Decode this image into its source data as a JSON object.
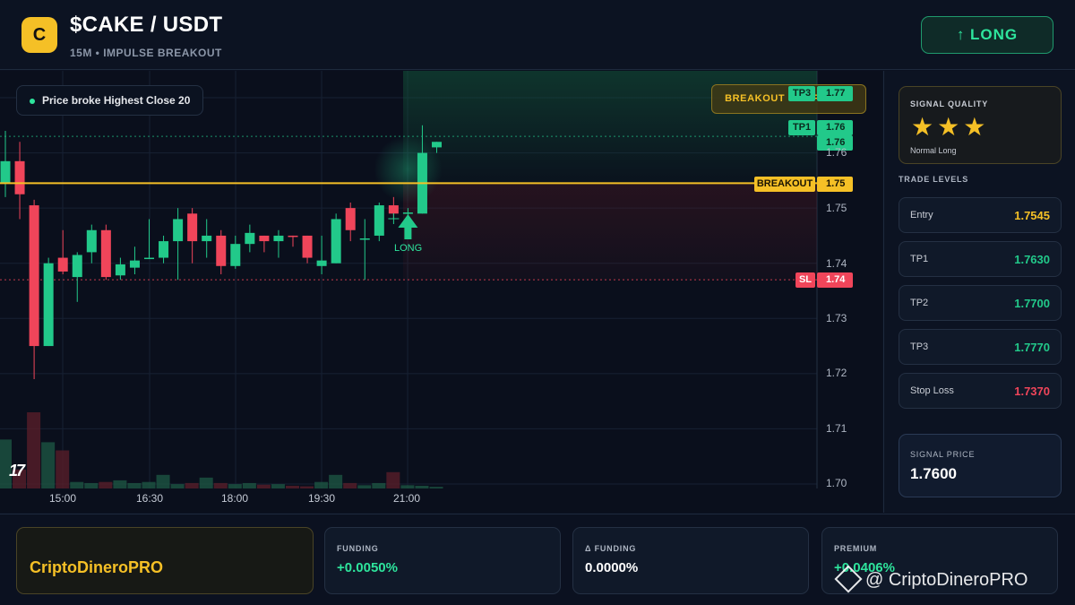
{
  "header": {
    "logo_letter": "C",
    "pair": "$CAKE / USDT",
    "subtitle": "15M • IMPULSE BREAKOUT",
    "direction_button": "↑ LONG"
  },
  "chart": {
    "badge": "Price broke Highest Close 20",
    "confirmed_badge": "BREAKOUT CONFIRMED",
    "tv_logo": "17",
    "long_marker_label": "LONG",
    "time_labels": [
      "15:00",
      "16:30",
      "18:00",
      "19:30",
      "21:00"
    ],
    "price_axis": [
      "1.76",
      "1.75",
      "1.74",
      "1.73",
      "1.72",
      "1.71",
      "1.70"
    ],
    "line_tags": {
      "tp1": {
        "label": "TP1",
        "value": "1.76"
      },
      "tp3": {
        "label": "TP3",
        "value": "1.77"
      },
      "current": {
        "value": "1.76"
      },
      "breakout": {
        "label": "BREAKOUT",
        "value": "1.75"
      },
      "sl": {
        "label": "SL",
        "value": "1.74"
      }
    },
    "colors": {
      "up": "#22c98a",
      "down": "#f0455a",
      "breakout": "#f5c026",
      "bg": "#0a0f1c"
    }
  },
  "chart_data": {
    "type": "candlestick",
    "interval": "15m",
    "y_axis": {
      "min": 1.7,
      "max": 1.77
    },
    "levels": {
      "tp1": 1.763,
      "tp3": 1.777,
      "breakout": 1.7545,
      "sl": 1.737
    },
    "candles": [
      {
        "o": 1.7545,
        "h": 1.764,
        "l": 1.752,
        "c": 1.7585
      },
      {
        "o": 1.7585,
        "h": 1.762,
        "l": 1.748,
        "c": 1.7525
      },
      {
        "o": 1.7505,
        "h": 1.7515,
        "l": 1.719,
        "c": 1.725
      },
      {
        "o": 1.725,
        "h": 1.741,
        "l": 1.725,
        "c": 1.74
      },
      {
        "o": 1.741,
        "h": 1.746,
        "l": 1.738,
        "c": 1.7385
      },
      {
        "o": 1.7375,
        "h": 1.742,
        "l": 1.733,
        "c": 1.7415
      },
      {
        "o": 1.742,
        "h": 1.747,
        "l": 1.74,
        "c": 1.746
      },
      {
        "o": 1.746,
        "h": 1.747,
        "l": 1.737,
        "c": 1.7375
      },
      {
        "o": 1.7378,
        "h": 1.741,
        "l": 1.737,
        "c": 1.7398
      },
      {
        "o": 1.7392,
        "h": 1.743,
        "l": 1.738,
        "c": 1.7405
      },
      {
        "o": 1.741,
        "h": 1.748,
        "l": 1.741,
        "c": 1.741
      },
      {
        "o": 1.741,
        "h": 1.745,
        "l": 1.74,
        "c": 1.744
      },
      {
        "o": 1.744,
        "h": 1.75,
        "l": 1.737,
        "c": 1.748
      },
      {
        "o": 1.749,
        "h": 1.75,
        "l": 1.74,
        "c": 1.744
      },
      {
        "o": 1.744,
        "h": 1.748,
        "l": 1.741,
        "c": 1.745
      },
      {
        "o": 1.745,
        "h": 1.746,
        "l": 1.738,
        "c": 1.7395
      },
      {
        "o": 1.7395,
        "h": 1.745,
        "l": 1.739,
        "c": 1.7435
      },
      {
        "o": 1.7435,
        "h": 1.747,
        "l": 1.742,
        "c": 1.7455
      },
      {
        "o": 1.745,
        "h": 1.745,
        "l": 1.742,
        "c": 1.744
      },
      {
        "o": 1.744,
        "h": 1.746,
        "l": 1.741,
        "c": 1.745
      },
      {
        "o": 1.745,
        "h": 1.745,
        "l": 1.743,
        "c": 1.7448
      },
      {
        "o": 1.745,
        "h": 1.745,
        "l": 1.74,
        "c": 1.741
      },
      {
        "o": 1.7395,
        "h": 1.745,
        "l": 1.738,
        "c": 1.7405
      },
      {
        "o": 1.74,
        "h": 1.749,
        "l": 1.74,
        "c": 1.748
      },
      {
        "o": 1.75,
        "h": 1.751,
        "l": 1.744,
        "c": 1.746
      },
      {
        "o": 1.7443,
        "h": 1.748,
        "l": 1.737,
        "c": 1.7445
      },
      {
        "o": 1.745,
        "h": 1.751,
        "l": 1.744,
        "c": 1.7505
      },
      {
        "o": 1.7505,
        "h": 1.752,
        "l": 1.748,
        "c": 1.749
      },
      {
        "o": 1.749,
        "h": 1.75,
        "l": 1.748,
        "c": 1.7492
      },
      {
        "o": 1.749,
        "h": 1.765,
        "l": 1.749,
        "c": 1.76
      },
      {
        "o": 1.761,
        "h": 1.762,
        "l": 1.76,
        "c": 1.762
      }
    ],
    "volumes": [
      0.9,
      0.35,
      1.4,
      0.85,
      0.7,
      0.12,
      0.1,
      0.12,
      0.15,
      0.1,
      0.12,
      0.25,
      0.08,
      0.1,
      0.2,
      0.1,
      0.08,
      0.1,
      0.07,
      0.08,
      0.05,
      0.04,
      0.12,
      0.25,
      0.1,
      0.06,
      0.1,
      0.3,
      0.06,
      0.05,
      0.03
    ],
    "time_labels": [
      "15:00",
      "16:30",
      "18:00",
      "19:30",
      "21:00"
    ]
  },
  "panel": {
    "signal_quality_title": "SIGNAL QUALITY",
    "stars": "★★★",
    "quality_note": "Normal Long",
    "levels_title": "TRADE LEVELS",
    "levels": [
      {
        "name": "Entry",
        "value": "1.7545",
        "color": "#f5c026"
      },
      {
        "name": "TP1",
        "value": "1.7630",
        "color": "#22c98a"
      },
      {
        "name": "TP2",
        "value": "1.7700",
        "color": "#22c98a"
      },
      {
        "name": "TP3",
        "value": "1.7770",
        "color": "#22c98a"
      },
      {
        "name": "Stop Loss",
        "value": "1.7370",
        "color": "#f0455a"
      }
    ],
    "signal_price_title": "SIGNAL PRICE",
    "signal_price": "1.7600"
  },
  "footer": {
    "brand": "CriptoDineroPRO",
    "stats": [
      {
        "title": "FUNDING",
        "value": "+0.0050%",
        "color": "#2ee59d"
      },
      {
        "title": "Δ FUNDING",
        "value": "0.0000%",
        "color": "#ffffff"
      },
      {
        "title": "PREMIUM",
        "value": "+0.0406%",
        "color": "#2ee59d"
      }
    ],
    "watermark": "@ CriptoDineroPRO"
  }
}
